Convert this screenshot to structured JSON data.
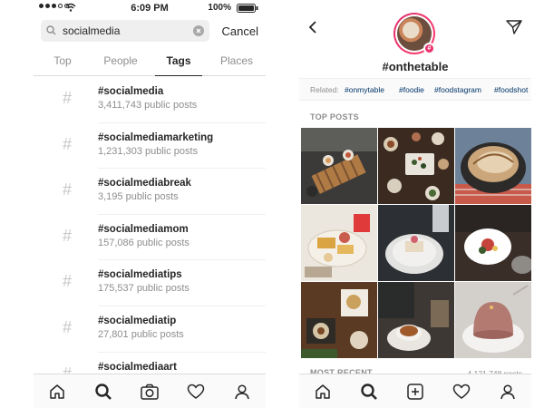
{
  "left": {
    "status": {
      "time": "6:09 PM",
      "battery": "100%"
    },
    "search": {
      "query": "socialmedia",
      "cancel": "Cancel"
    },
    "tabs": [
      {
        "label": "Top",
        "active": false
      },
      {
        "label": "People",
        "active": false
      },
      {
        "label": "Tags",
        "active": true
      },
      {
        "label": "Places",
        "active": false
      }
    ],
    "results": [
      {
        "tag": "#socialmedia",
        "count": "3,411,743 public posts"
      },
      {
        "tag": "#socialmediamarketing",
        "count": "1,231,303 public posts"
      },
      {
        "tag": "#socialmediabreak",
        "count": "3,195 public posts"
      },
      {
        "tag": "#socialmediamom",
        "count": "157,086 public posts"
      },
      {
        "tag": "#socialmediatips",
        "count": "175,537 public posts"
      },
      {
        "tag": "#socialmediatip",
        "count": "27,801 public posts"
      },
      {
        "tag": "#socialmediaart",
        "count": ""
      }
    ],
    "tabbar": [
      "home-icon",
      "search-icon",
      "camera-icon",
      "heart-icon",
      "profile-icon"
    ]
  },
  "right": {
    "hashtag": "#onthetable",
    "related_label": "Related:",
    "related": [
      "#onmytable",
      "#foodie",
      "#foodstagram",
      "#foodshot"
    ],
    "top_posts_label": "TOP POSTS",
    "most_recent_label": "MOST RECENT",
    "most_recent_count": "4,121,748 posts",
    "photos": [
      "table-setting-photo",
      "dinner-spread-photo",
      "bread-pan-photo",
      "sweets-plate-photo",
      "cake-slice-photo",
      "dessert-plate-photo",
      "pastry-table-photo",
      "tea-cup-photo",
      "mousse-dome-photo"
    ],
    "tabbar": [
      "home-icon",
      "search-icon",
      "add-post-icon",
      "heart-icon",
      "profile-icon"
    ]
  },
  "colors": {
    "accent": "#e8326d",
    "link": "#003569",
    "muted": "#8e8e8e"
  }
}
